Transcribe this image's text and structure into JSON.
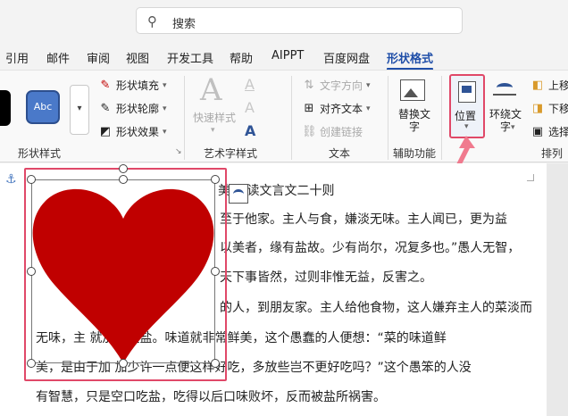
{
  "search": {
    "placeholder": "搜索"
  },
  "tabs": [
    "引用",
    "邮件",
    "审阅",
    "视图",
    "开发工具",
    "帮助",
    "AIPPT",
    "百度网盘",
    "形状格式"
  ],
  "ribbon": {
    "shape_styles": {
      "style_sample": "Abc",
      "fill": "形状填充",
      "outline": "形状轮廓",
      "effects": "形状效果",
      "label": "形状样式"
    },
    "wordart": {
      "quick_styles": "快速样式",
      "label": "艺术字样式"
    },
    "text": {
      "direction": "文字方向",
      "align": "对齐文本",
      "link": "创建链接",
      "label": "文本"
    },
    "accessibility": {
      "alt_text": "替换文字",
      "label": "辅助功能"
    },
    "arrange": {
      "position": "位置",
      "wrap": "环绕文字",
      "bring_forward": "上移",
      "send_backward": "下移",
      "selection": "选择",
      "label": "排列"
    }
  },
  "document": {
    "lines": [
      "美  必读文言文二十则",
      "至于他家。主人与食，嫌淡无味。主人闻已，更为益",
      "以美者，缘有盐故。少有尚尔，况复多也。”愚人无智，",
      "天下事皆然，过则非惟无益，反害之。",
      "的人，到朋友家。主人给他食物，这人嫌弃主人的菜淡而",
      "无味，主          就加了些盐。味道就非常鲜美，这个愚蠢的人便想：“菜的味道鲜",
      "美，是由于加        加少许一点便这样好吃，多放些岂不更好吃吗？”这个愚笨的人没",
      "有智慧，只是空口吃盐，吃得以后口味败坏，反而被盐所祸害。"
    ]
  },
  "colors": {
    "heart": "#c00000",
    "accent": "#1f4ea8",
    "highlight": "#e04868"
  }
}
